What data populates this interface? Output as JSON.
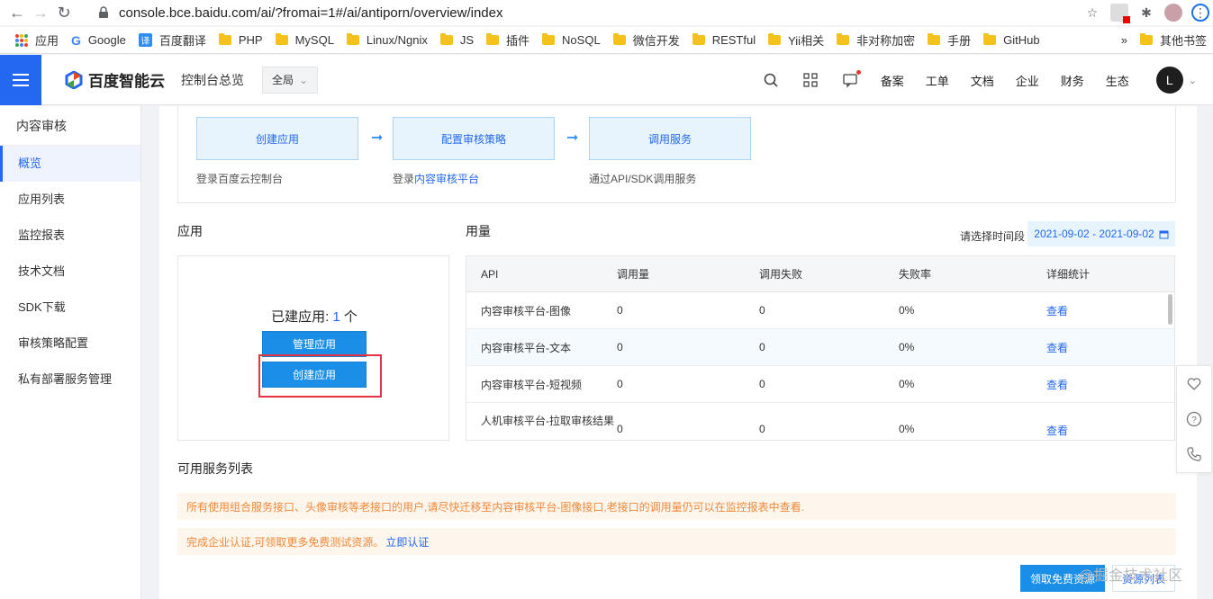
{
  "browser": {
    "url": "console.bce.baidu.com/ai/?fromai=1#/ai/antiporn/overview/index",
    "bookmarks": [
      "应用",
      "Google",
      "百度翻译",
      "PHP",
      "MySQL",
      "Linux/Ngnix",
      "JS",
      "插件",
      "NoSQL",
      "微信开发",
      "RESTful",
      "Yii相关",
      "非对称加密",
      "手册",
      "GitHub"
    ],
    "more": "»",
    "other_bookmarks": "其他书签"
  },
  "header": {
    "logo": "百度智能云",
    "console": "控制台总览",
    "scope": "全局",
    "links": [
      "备案",
      "工单",
      "文档",
      "企业",
      "财务",
      "生态"
    ],
    "avatar": "L"
  },
  "sidebar": {
    "title": "内容审核",
    "items": [
      "概览",
      "应用列表",
      "监控报表",
      "技术文档",
      "SDK下载",
      "审核策略配置",
      "私有部署服务管理"
    ]
  },
  "flow": {
    "steps": [
      {
        "label": "创建应用",
        "desc": "登录百度云控制台"
      },
      {
        "label": "配置审核策略",
        "desc_prefix": "登录",
        "desc_link": "内容审核平台"
      },
      {
        "label": "调用服务",
        "desc": "通过API/SDK调用服务"
      }
    ]
  },
  "apps": {
    "title": "应用",
    "count_label": "已建应用:",
    "count": "1",
    "unit": "个",
    "manage_button": "管理应用",
    "create_button": "创建应用"
  },
  "usage": {
    "title": "用量",
    "date_label": "请选择时间段",
    "date_range": "2021-09-02 - 2021-09-02",
    "columns": [
      "API",
      "调用量",
      "调用失败",
      "失败率",
      "详细统计"
    ],
    "rows": [
      {
        "api": "内容审核平台-图像",
        "calls": "0",
        "failed": "0",
        "rate": "0%",
        "detail": "查看"
      },
      {
        "api": "内容审核平台-文本",
        "calls": "0",
        "failed": "0",
        "rate": "0%",
        "detail": "查看"
      },
      {
        "api": "内容审核平台-短视频",
        "calls": "0",
        "failed": "0",
        "rate": "0%",
        "detail": "查看"
      },
      {
        "api": "人机审核平台-拉取审核结果",
        "calls": "0",
        "failed": "0",
        "rate": "0%",
        "detail": "查看"
      }
    ]
  },
  "services": {
    "title": "可用服务列表",
    "notice1": "所有使用组合服务接口、头像审核等老接口的用户,请尽快迁移至内容审核平台-图像接口,老接口的调用量仍可以在监控报表中查看.",
    "notice2_text": "完成企业认证,可领取更多免费测试资源。",
    "notice2_link": "立即认证"
  },
  "footer": {
    "claim_button": "领取免费资源",
    "resource_list": "资源列表",
    "watermark": "@掘金技术社区"
  }
}
